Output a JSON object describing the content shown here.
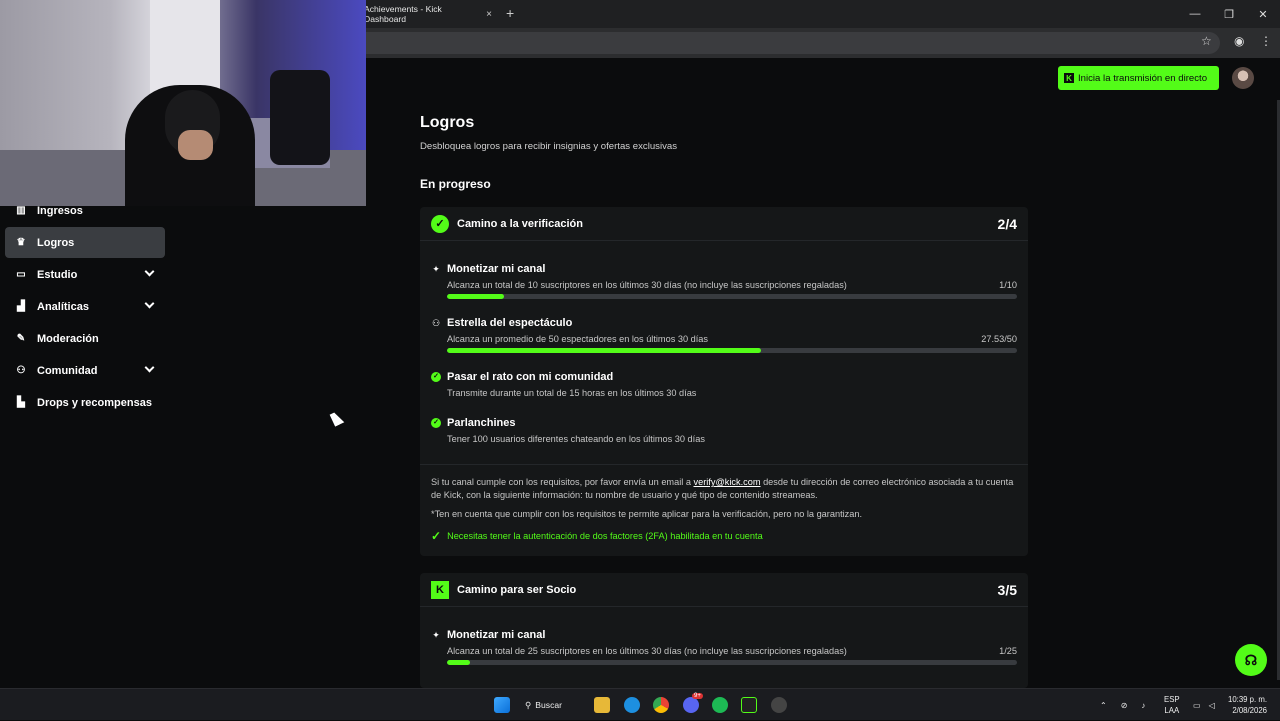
{
  "browser": {
    "tab_title": "Achievements - Kick Dashboard",
    "tab_close": "×",
    "new_tab": "+",
    "window_controls": [
      "—",
      "❐",
      "✕"
    ]
  },
  "sidebar": {
    "items": [
      {
        "label": "Ingresos",
        "icon": "chart-icon"
      },
      {
        "label": "Logros",
        "icon": "trophy-icon",
        "active": true
      },
      {
        "label": "Estudio",
        "icon": "studio-icon",
        "expandable": true
      },
      {
        "label": "Analíticas",
        "icon": "analytics-icon",
        "expandable": true
      },
      {
        "label": "Moderación",
        "icon": "wrench-icon"
      },
      {
        "label": "Comunidad",
        "icon": "community-icon",
        "expandable": true
      },
      {
        "label": "Drops y recompensas",
        "icon": "drops-icon"
      }
    ]
  },
  "header": {
    "golive_label": "Inicia la transmisión en directo"
  },
  "page": {
    "title": "Logros",
    "subtitle": "Desbloquea logros para recibir insignias y ofertas exclusivas",
    "section": "En progreso"
  },
  "card1": {
    "title": "Camino a la verificación",
    "count": "2/4",
    "items": [
      {
        "name": "Monetizar mi canal",
        "desc": "Alcanza un total de 10 suscriptores en los últimos 30 días (no incluye las suscripciones regaladas)",
        "progress": "1/10",
        "fraction": 0.1,
        "status": "in-progress"
      },
      {
        "name": "Estrella del espectáculo",
        "desc": "Alcanza un promedio de 50 espectadores en los últimos 30 días",
        "progress": "27.53/50",
        "fraction": 0.5506,
        "status": "in-progress"
      },
      {
        "name": "Pasar el rato con mi comunidad",
        "desc": "Transmite durante un total de 15 horas en los últimos 30 días",
        "status": "done"
      },
      {
        "name": "Parlanchines",
        "desc": "Tener 100 usuarios diferentes chateando en los últimos 30 días",
        "status": "done"
      }
    ],
    "note_pre": "Si tu canal cumple con los requisitos, por favor envía un email a ",
    "note_email": "verify@kick.com",
    "note_post": " desde tu dirección de correo electrónico asociada a tu cuenta de Kick, con la siguiente información: tu nombre de usuario y qué tipo de contenido streameas.",
    "disclaimer": "*Ten en cuenta que cumplir con los requisitos te permite aplicar para la verificación, pero no la garantizan.",
    "twofa": "Necesitas tener la autenticación de dos factores (2FA) habilitada en tu cuenta"
  },
  "card2": {
    "title": "Camino para ser Socio",
    "count": "3/5",
    "items": [
      {
        "name": "Monetizar mi canal",
        "desc": "Alcanza un total de 25 suscriptores en los últimos 30 días (no incluye las suscripciones regaladas)",
        "progress": "1/25",
        "fraction": 0.04,
        "status": "in-progress"
      }
    ]
  },
  "taskbar": {
    "search_label": "Buscar",
    "lang_top": "ESP",
    "lang_bottom": "LAA",
    "time": "10:39 p. m.",
    "date": "2/08/2026",
    "discord_badge": "9+"
  },
  "colors": {
    "accent": "#53fc18",
    "background": "#0b0c0d",
    "card": "#151718"
  }
}
